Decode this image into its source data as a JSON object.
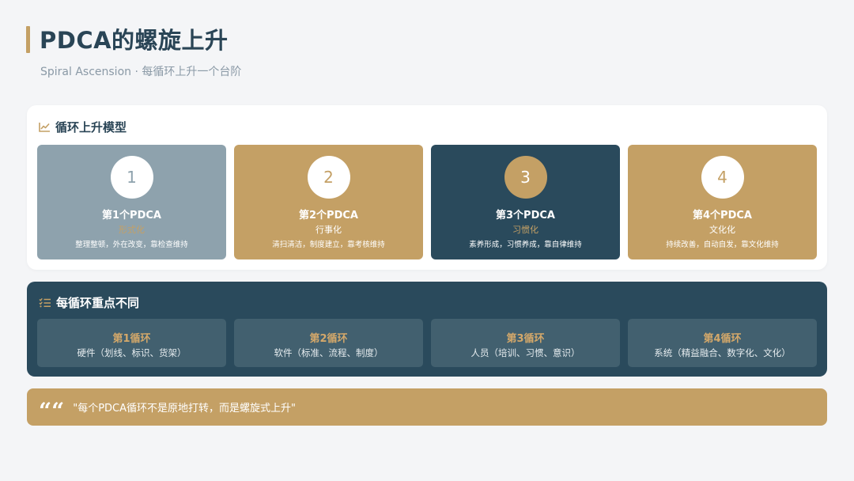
{
  "header": {
    "title": "PDCA的螺旋上升",
    "subtitle": "Spiral Ascension · 每循环上升一个台阶"
  },
  "model_section": {
    "heading": "循环上升模型",
    "icon": "line-chart-icon",
    "cards": [
      {
        "number": "1",
        "name": "第1个PDCA",
        "stage": "形式化",
        "desc": "整理整顿，外在改变，靠检查维持",
        "bg": "#8ea2ad",
        "circle_bg": "#ffffff",
        "number_color": "#8ea2ad",
        "name_color": "#ffffff",
        "stage_color": "#c4a065",
        "desc_color": "#ffffff"
      },
      {
        "number": "2",
        "name": "第2个PDCA",
        "stage": "行事化",
        "desc": "清扫清洁，制度建立，靠考核维持",
        "bg": "#c4a065",
        "circle_bg": "#ffffff",
        "number_color": "#c4a065",
        "name_color": "#ffffff",
        "stage_color": "#ffffff",
        "desc_color": "#ffffff"
      },
      {
        "number": "3",
        "name": "第3个PDCA",
        "stage": "习惯化",
        "desc": "素养形成，习惯养成，靠自律维持",
        "bg": "#2a4a5c",
        "circle_bg": "#c4a065",
        "number_color": "#ffffff",
        "name_color": "#ffffff",
        "stage_color": "#c4a065",
        "desc_color": "#ffffff"
      },
      {
        "number": "4",
        "name": "第4个PDCA",
        "stage": "文化化",
        "desc": "持续改善，自动自发，靠文化维持",
        "bg": "#c4a065",
        "circle_bg": "#ffffff",
        "number_color": "#c4a065",
        "name_color": "#ffffff",
        "stage_color": "#ffffff",
        "desc_color": "#ffffff"
      }
    ]
  },
  "focus_section": {
    "heading": "每循环重点不同",
    "icon": "list-check-icon",
    "cards": [
      {
        "title": "第1循环",
        "desc": "硬件（划线、标识、货架）"
      },
      {
        "title": "第2循环",
        "desc": "软件（标准、流程、制度）"
      },
      {
        "title": "第3循环",
        "desc": "人员（培训、习惯、意识）"
      },
      {
        "title": "第4循环",
        "desc": "系统（精益融合、数字化、文化）"
      }
    ]
  },
  "quote": {
    "mark": "““",
    "text": "\"每个PDCA循环不是原地打转，而是螺旋式上升\""
  },
  "colors": {
    "accent_gold": "#c4a065",
    "navy": "#2a4a5c",
    "slate": "#8ea2ad",
    "background": "#f4f5f7"
  }
}
